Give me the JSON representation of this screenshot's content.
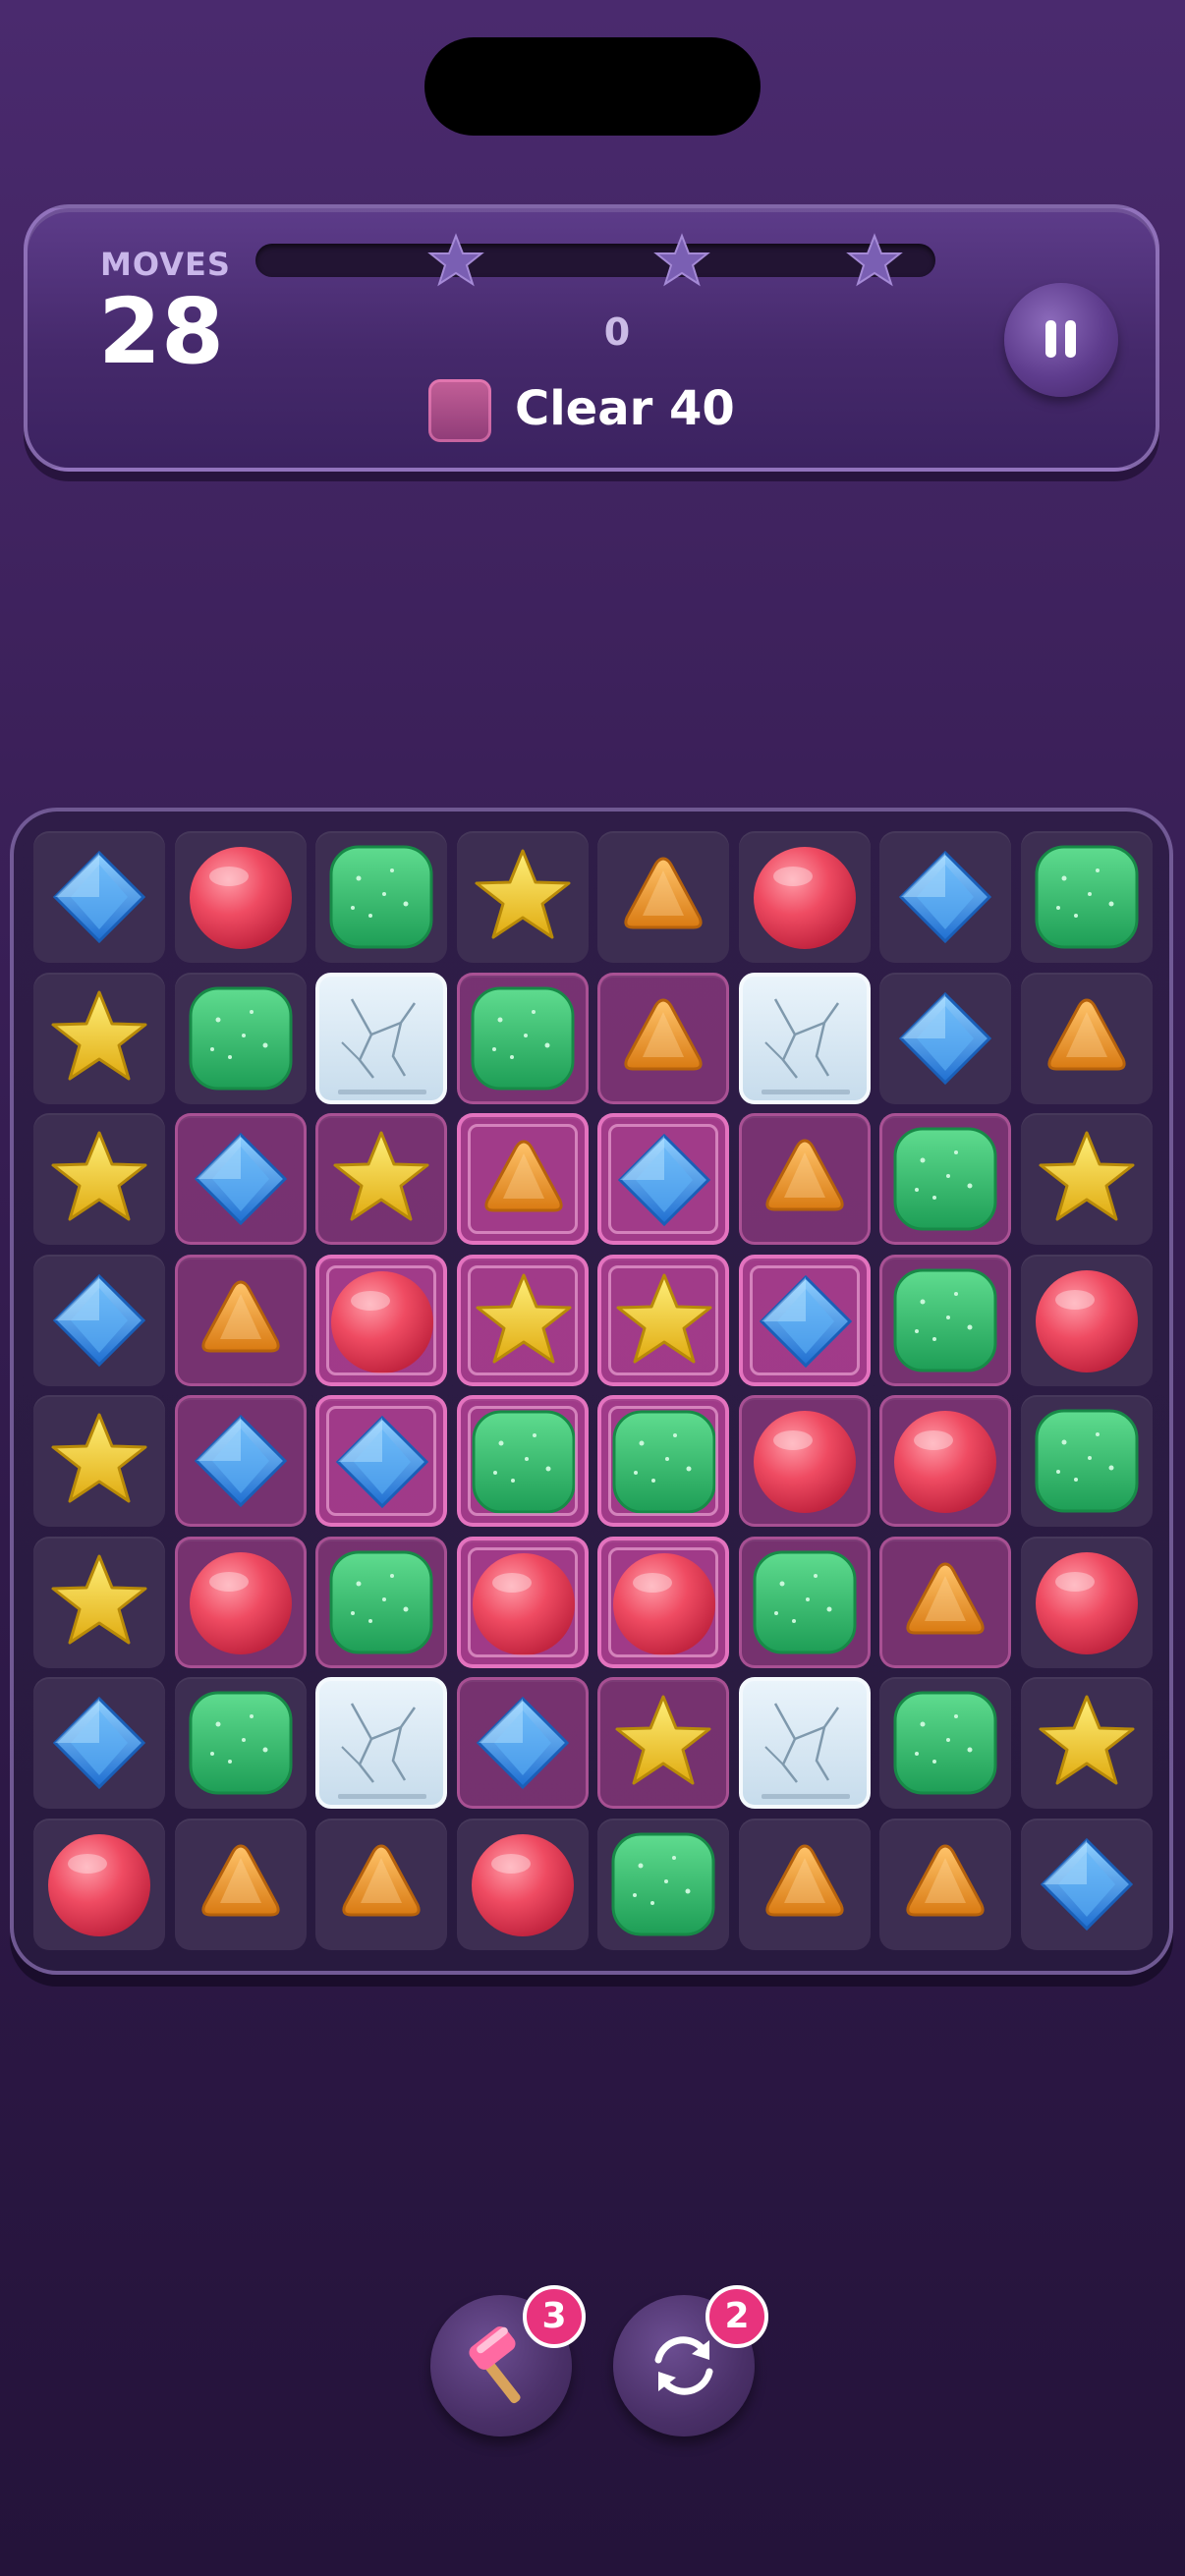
{
  "hud": {
    "moves_label": "MOVES",
    "moves_value": "28",
    "score": "0",
    "score_progress": 0,
    "star_milestones": 3,
    "goal_text": "Clear 40",
    "goal_icon": "jelly-tile"
  },
  "board": {
    "rows": 8,
    "cols": 8,
    "legend": {
      "B": "blue-diamond",
      "R": "red-ball",
      "G": "green-jelly",
      "Y": "yellow-star",
      "O": "orange-triangle",
      "X": "cracked-ice-block"
    },
    "overlay_legend": {
      ".": "none",
      "j": "jelly-single",
      "J": "jelly-double"
    },
    "pieces": [
      "BRGYORBG",
      "YGXGOXBO",
      "YBYOBOGY",
      "BORYYBGR",
      "YBBGGRRG",
      "YRGRRGOR",
      "BGXBYXGY",
      "ROORGOOB"
    ],
    "overlays": [
      "........",
      "...jj...",
      ".jjJJjj.",
      ".jJJJJj.",
      ".jJJJjj.",
      ".jjJJjj.",
      "...jj...",
      "........"
    ]
  },
  "boosters": [
    {
      "name": "hammer",
      "icon": "hammer-icon",
      "count": "3"
    },
    {
      "name": "shuffle",
      "icon": "shuffle-icon",
      "count": "2"
    }
  ],
  "colors": {
    "background": "#3b2059",
    "hud_panel": "#4b2f73",
    "jelly": "#c8469f",
    "badge": "#e8337d",
    "red": "#e84a5f",
    "green": "#2fb86a",
    "blue": "#3b8fe6",
    "yellow": "#f4cf2a",
    "orange": "#ee9a2c"
  }
}
